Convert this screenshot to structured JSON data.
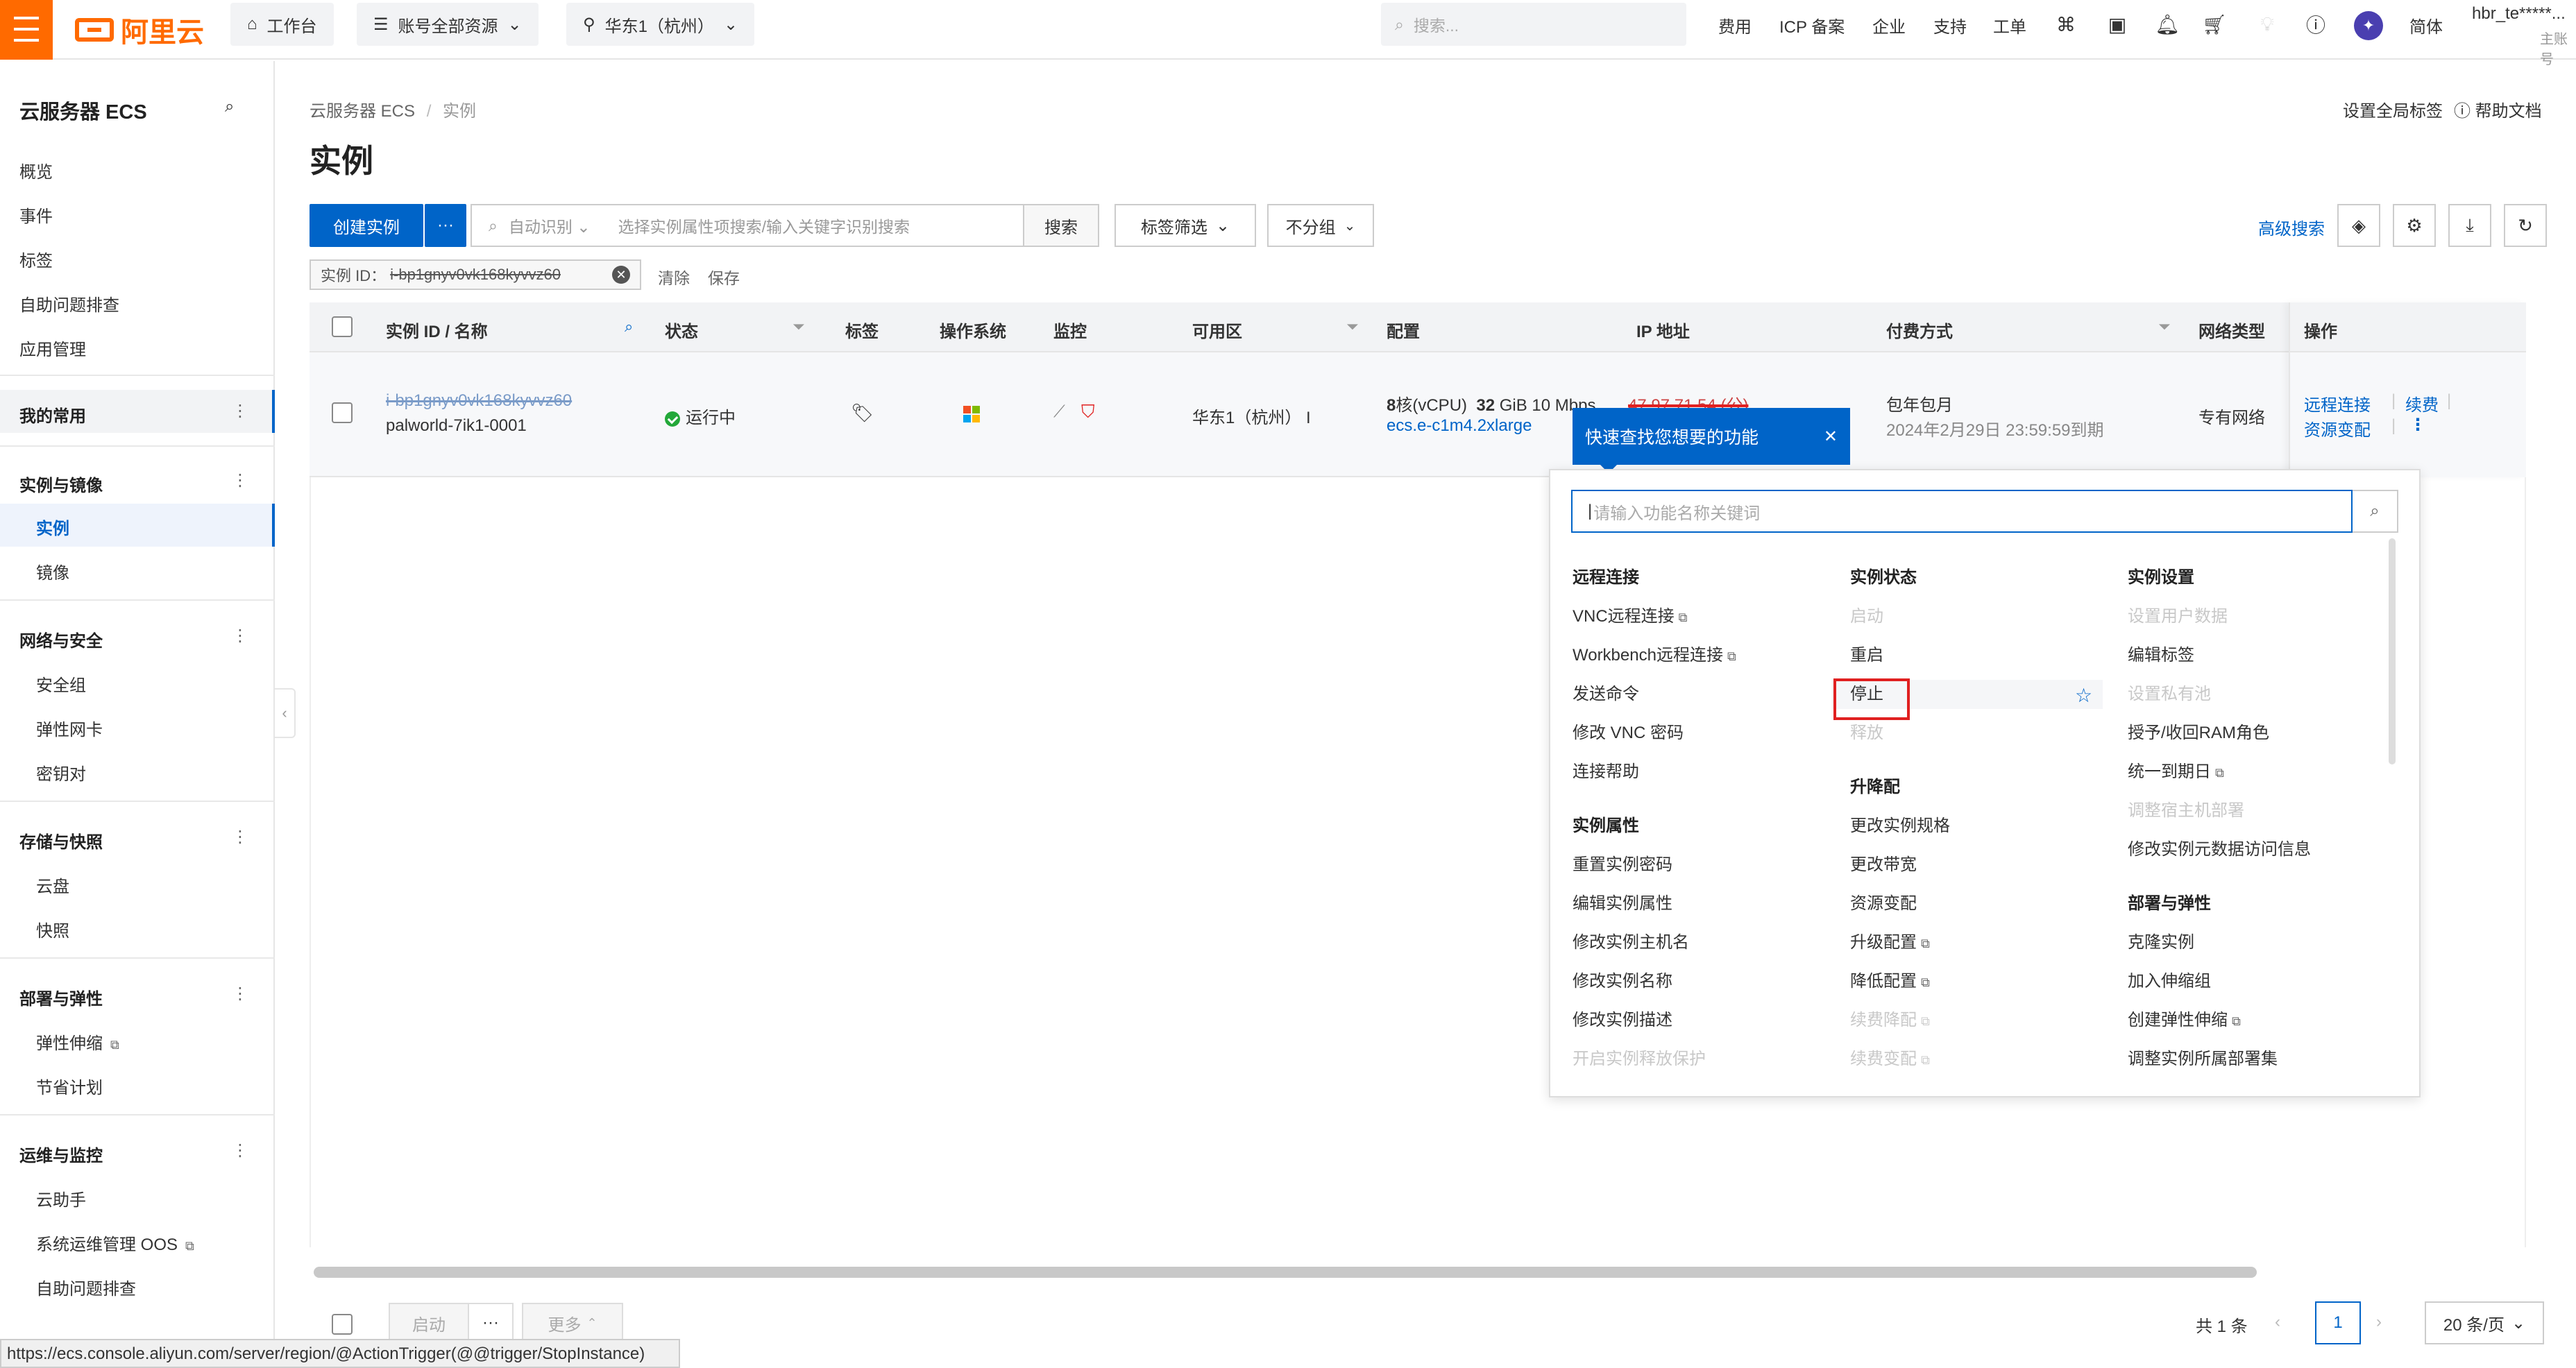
{
  "topbar": {
    "logo": "阿里云",
    "workbench": "工作台",
    "account_resources": "账号全部资源",
    "region": "华东1（杭州）",
    "search_placeholder": "搜索...",
    "links": [
      "费用",
      "ICP 备案",
      "企业",
      "支持",
      "工单"
    ],
    "lang": "简体",
    "user": "hbr_te*****...",
    "user_sub": "主账号"
  },
  "sidebar": {
    "title": "云服务器 ECS",
    "top_items": [
      "概览",
      "事件",
      "标签",
      "自助问题排查",
      "应用管理"
    ],
    "favorites": "我的常用",
    "groups": {
      "instances_images": {
        "title": "实例与镜像",
        "items": [
          "实例",
          "镜像"
        ]
      },
      "network_security": {
        "title": "网络与安全",
        "items": [
          "安全组",
          "弹性网卡",
          "密钥对"
        ]
      },
      "storage_snapshots": {
        "title": "存储与快照",
        "items": [
          "云盘",
          "快照"
        ]
      },
      "deploy_elastic": {
        "title": "部署与弹性",
        "items": [
          "弹性伸缩",
          "节省计划"
        ]
      },
      "ops_monitor": {
        "title": "运维与监控",
        "items": [
          "云助手",
          "系统运维管理 OOS",
          "自助问题排查"
        ]
      }
    }
  },
  "main": {
    "breadcrumb": [
      "云服务器 ECS",
      "实例"
    ],
    "title": "实例",
    "set_global_tags": "设置全局标签",
    "help_docs": "帮助文档",
    "create_instance": "创建实例",
    "more_dots": "···",
    "auto_identify": "自动识别",
    "search_placeholder": "选择实例属性项搜索/输入关键字识别搜索",
    "search": "搜索",
    "tag_filter": "标签筛选",
    "no_group": "不分组",
    "advanced_search": "高级搜索",
    "filter_label": "实例 ID：",
    "filter_value": "i-bp1gnyv0vk168kyvvz60",
    "clear": "清除",
    "save": "保存"
  },
  "table": {
    "headers": [
      "实例 ID / 名称",
      "状态",
      "标签",
      "操作系统",
      "监控",
      "可用区",
      "配置",
      "IP 地址",
      "付费方式",
      "网络类型",
      "操作"
    ],
    "row": {
      "id": "i-bp1gnyv0vk168kyvvz60",
      "name": "palworld-7ik1-0001",
      "status": "运行中",
      "zone": "华东1（杭州） I",
      "config_cores": "8",
      "config_cores_unit": "核(vCPU)",
      "config_mem": "32",
      "config_mem_unit": "GiB",
      "config_bw": "10 Mbps",
      "instance_type": "ecs.e-c1m4.2xlarge",
      "ip": "47.97.71.54 (公)",
      "billing": "包年包月",
      "expire": "2024年2月29日 23:59:59到期",
      "network": "专有网络",
      "ops": [
        "远程连接",
        "续费",
        "资源变配"
      ]
    }
  },
  "footer": {
    "start": "启动",
    "more": "更多",
    "total": "共 1 条",
    "current_page": "1",
    "page_size": "20 条/页"
  },
  "statusbar_url": "https://ecs.console.aliyun.com/server/region/@ActionTrigger(@@trigger/StopInstance)",
  "tooltip": {
    "text": "快速查找您想要的功能"
  },
  "popup": {
    "search_placeholder": "请输入功能名称关键词",
    "col1": [
      {
        "type": "head",
        "label": "远程连接"
      },
      {
        "label": "VNC远程连接",
        "ext": true
      },
      {
        "label": "Workbench远程连接",
        "ext": true
      },
      {
        "label": "发送命令"
      },
      {
        "label": "修改 VNC 密码"
      },
      {
        "label": "连接帮助"
      },
      {
        "type": "head",
        "label": "实例属性"
      },
      {
        "label": "重置实例密码"
      },
      {
        "label": "编辑实例属性"
      },
      {
        "label": "修改实例主机名"
      },
      {
        "label": "修改实例名称"
      },
      {
        "label": "修改实例描述"
      },
      {
        "label": "开启实例释放保护",
        "disabled": true
      }
    ],
    "col2": [
      {
        "type": "head",
        "label": "实例状态"
      },
      {
        "label": "启动",
        "disabled": true
      },
      {
        "label": "重启"
      },
      {
        "label": "停止"
      },
      {
        "label": "释放",
        "disabled": true
      },
      {
        "type": "head",
        "label": "升降配"
      },
      {
        "label": "更改实例规格"
      },
      {
        "label": "更改带宽"
      },
      {
        "label": "资源变配"
      },
      {
        "label": "升级配置",
        "ext": true
      },
      {
        "label": "降低配置",
        "ext": true
      },
      {
        "label": "续费降配",
        "ext": true,
        "disabled": true
      },
      {
        "label": "续费变配",
        "ext": true,
        "disabled": true
      }
    ],
    "col3": [
      {
        "type": "head",
        "label": "实例设置"
      },
      {
        "label": "设置用户数据",
        "disabled": true
      },
      {
        "label": "编辑标签"
      },
      {
        "label": "设置私有池",
        "disabled": true
      },
      {
        "label": "授予/收回RAM角色"
      },
      {
        "label": "统一到期日",
        "ext": true
      },
      {
        "label": "调整宿主机部署",
        "disabled": true
      },
      {
        "label": "修改实例元数据访问信息"
      },
      {
        "type": "head",
        "label": "部署与弹性"
      },
      {
        "label": "克隆实例"
      },
      {
        "label": "加入伸缩组"
      },
      {
        "label": "创建弹性伸缩",
        "ext": true
      },
      {
        "label": "调整实例所属部署集"
      }
    ]
  }
}
